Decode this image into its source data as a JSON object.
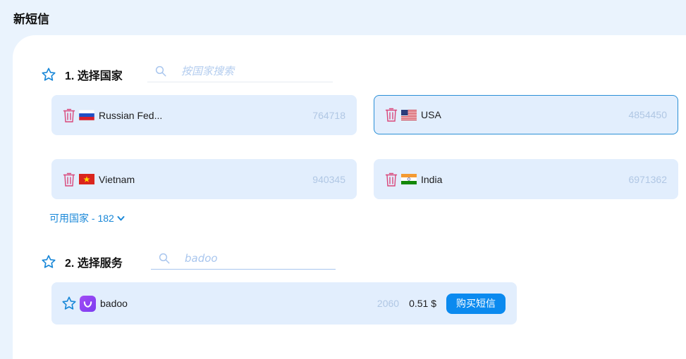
{
  "header": {
    "title": "新短信"
  },
  "countries_section": {
    "title": "1. 选择国家",
    "search_placeholder": "按国家搜索",
    "items": [
      {
        "name": "Russian Fed...",
        "count": "764718",
        "flag": "flag-russia",
        "selected": false
      },
      {
        "name": "USA",
        "count": "4854450",
        "flag": "flag-usa",
        "selected": true
      },
      {
        "name": "Vietnam",
        "count": "940345",
        "flag": "flag-vietnam",
        "selected": false
      },
      {
        "name": "India",
        "count": "6971362",
        "flag": "flag-india",
        "selected": false
      }
    ],
    "available_label": "可用国家 - 182"
  },
  "services_section": {
    "title": "2. 选择服务",
    "search_value": "badoo",
    "items": [
      {
        "name": "badoo",
        "count": "2060",
        "price": "0.51 $",
        "buy_label": "购买短信",
        "icon": "badoo-icon"
      }
    ]
  },
  "colors": {
    "accent": "#0b8aef",
    "card_bg": "#e2eefd",
    "trash": "#d9467a",
    "count_text": "#b0c7e4"
  }
}
